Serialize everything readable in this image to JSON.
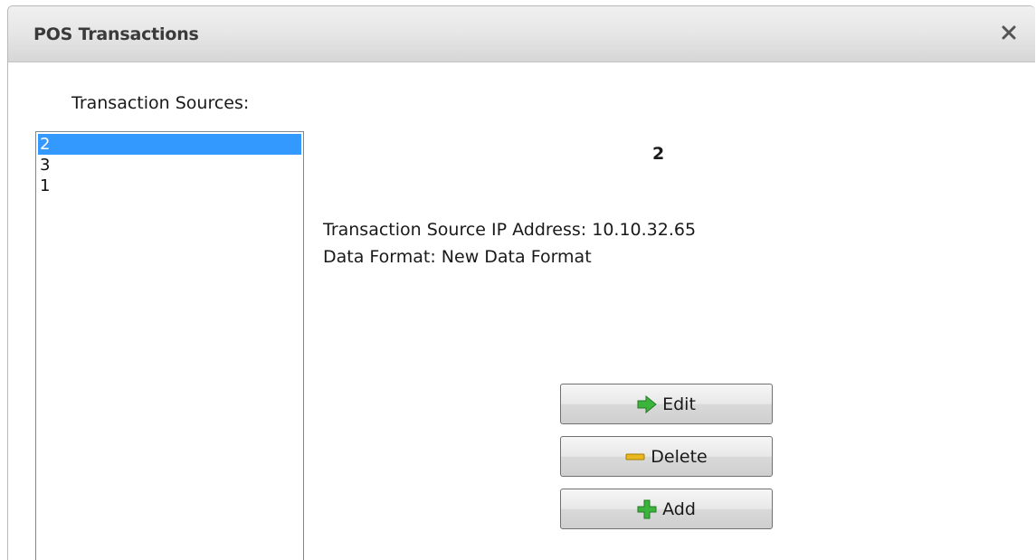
{
  "dialog": {
    "title": "POS Transactions",
    "close_icon": "close-icon"
  },
  "sources": {
    "label": "Transaction Sources:",
    "items": [
      {
        "label": "2",
        "selected": true
      },
      {
        "label": "3",
        "selected": false
      },
      {
        "label": "1",
        "selected": false
      }
    ]
  },
  "detail": {
    "name": "2",
    "ip_line": "Transaction Source IP Address: 10.10.32.65",
    "format_line": "Data Format: New Data Format"
  },
  "buttons": {
    "edit": {
      "label": "Edit",
      "icon": "green-arrow-right-icon"
    },
    "delete": {
      "label": "Delete",
      "icon": "yellow-minus-icon"
    },
    "add": {
      "label": "Add",
      "icon": "green-plus-icon"
    }
  },
  "colors": {
    "selection": "#3399ff",
    "icon_green": "#3cb43c",
    "icon_yellow": "#e8b820"
  }
}
